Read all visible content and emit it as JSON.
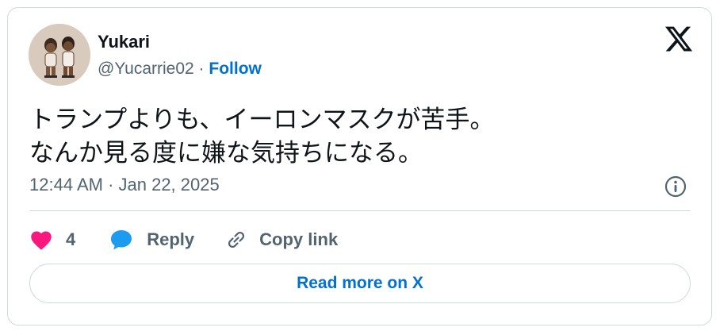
{
  "user": {
    "name": "Yukari",
    "handle": "@Yucarrie02",
    "separator": " · ",
    "follow_label": "Follow"
  },
  "tweet": {
    "lines": [
      "トランプよりも、イーロンマスクが苦手。",
      "なんか見る度に嫌な気持ちになる。"
    ],
    "timestamp": "12:44 AM · Jan 22, 2025"
  },
  "actions": {
    "like_count": "4",
    "reply_label": "Reply",
    "copy_label": "Copy link"
  },
  "read_more_label": "Read more on X",
  "icons": {
    "logo": "x-logo-icon",
    "info": "info-icon",
    "like": "heart-icon",
    "reply": "speech-bubble-icon",
    "copy": "link-icon"
  },
  "colors": {
    "link_blue": "#006fd6",
    "heart": "#f91880",
    "reply_blue": "#1d9bf0",
    "muted_text": "#536471",
    "border": "#cfd9de"
  }
}
